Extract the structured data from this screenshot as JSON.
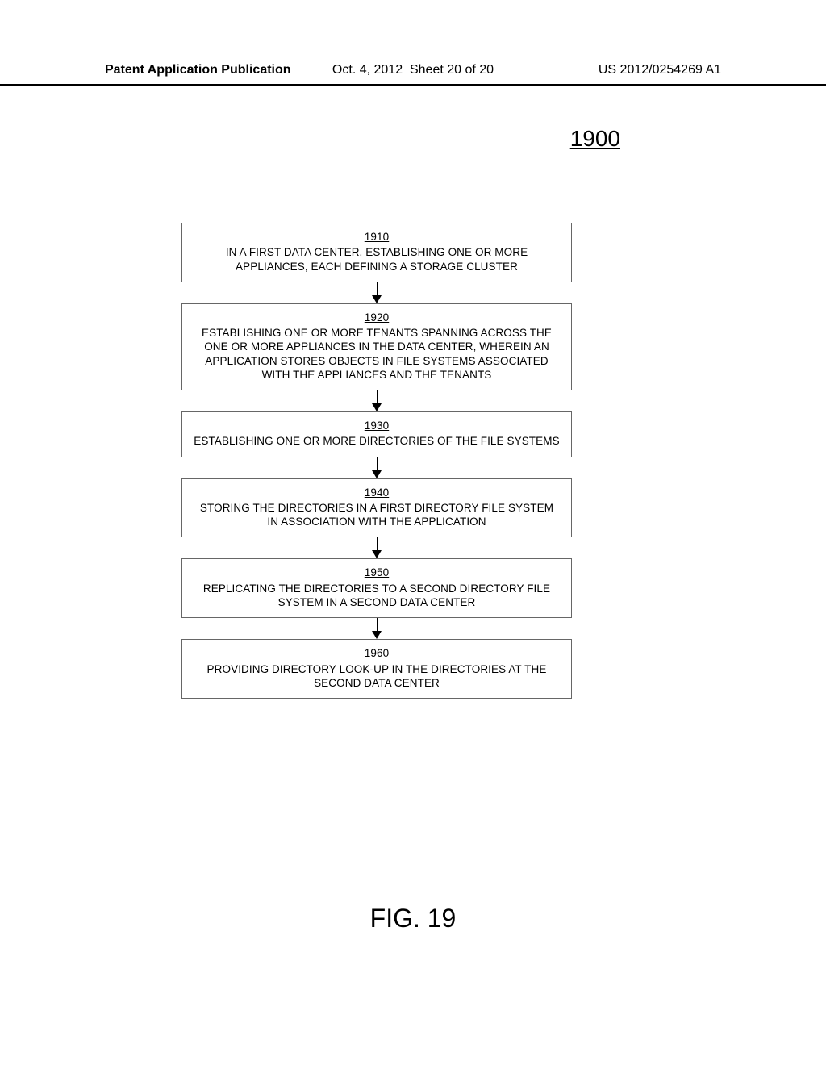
{
  "header": {
    "left": "Patent Application Publication",
    "date": "Oct. 4, 2012",
    "sheet": "Sheet 20 of 20",
    "pubno": "US 2012/0254269 A1"
  },
  "figure_number": "1900",
  "steps": [
    {
      "num": "1910",
      "text": "IN A FIRST DATA CENTER, ESTABLISHING ONE OR MORE APPLIANCES, EACH DEFINING A STORAGE CLUSTER"
    },
    {
      "num": "1920",
      "text": "ESTABLISHING ONE OR MORE TENANTS SPANNING ACROSS THE ONE OR MORE APPLIANCES IN THE DATA CENTER, WHEREIN AN APPLICATION STORES OBJECTS IN FILE SYSTEMS ASSOCIATED WITH THE APPLIANCES AND THE TENANTS"
    },
    {
      "num": "1930",
      "text": "ESTABLISHING ONE OR MORE DIRECTORIES OF THE FILE SYSTEMS"
    },
    {
      "num": "1940",
      "text": "STORING THE DIRECTORIES IN A FIRST DIRECTORY FILE SYSTEM IN ASSOCIATION WITH THE APPLICATION"
    },
    {
      "num": "1950",
      "text": "REPLICATING THE DIRECTORIES TO A SECOND DIRECTORY FILE SYSTEM IN A SECOND DATA CENTER"
    },
    {
      "num": "1960",
      "text": "PROVIDING DIRECTORY LOOK-UP IN THE DIRECTORIES AT THE SECOND DATA CENTER"
    }
  ],
  "figure_label": "FIG. 19"
}
